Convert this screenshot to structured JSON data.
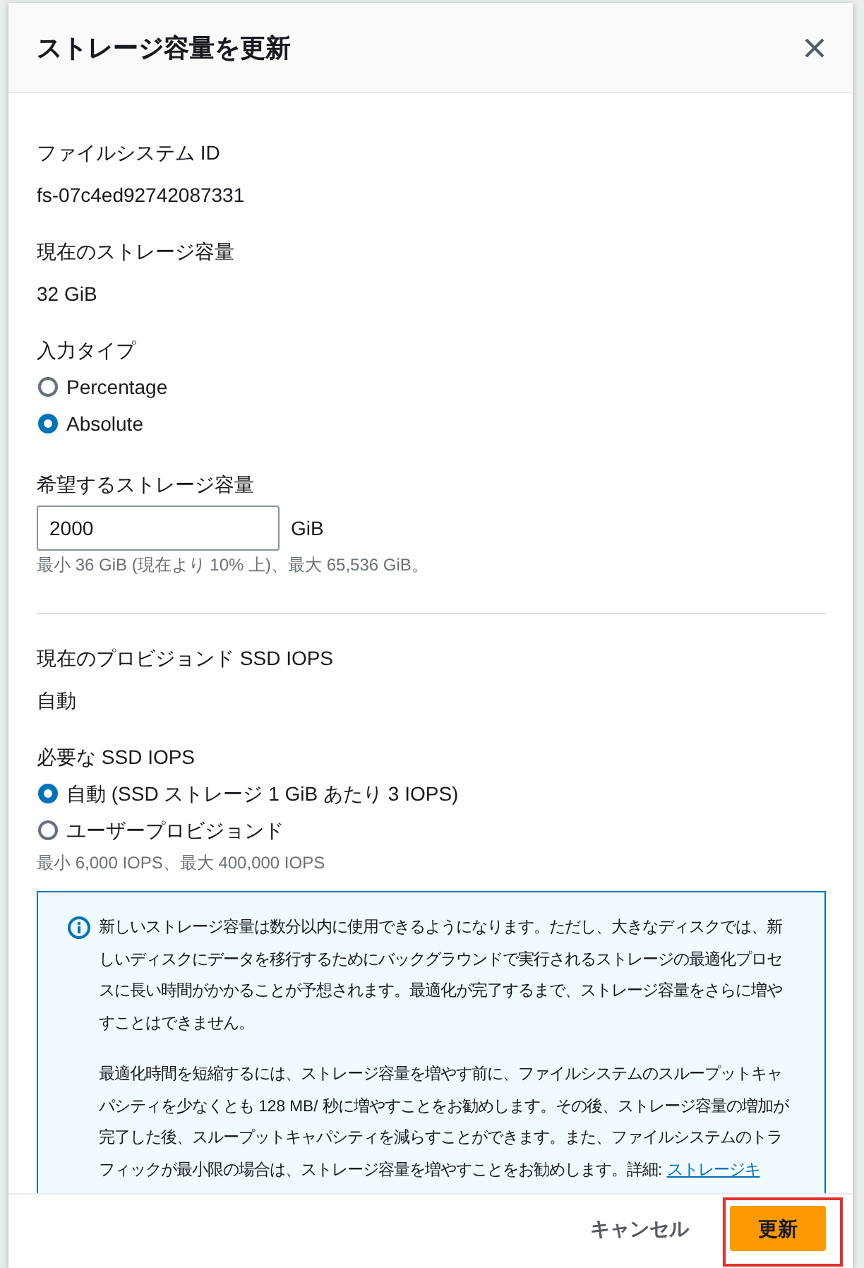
{
  "dialog": {
    "title": "ストレージ容量を更新"
  },
  "fields": [
    {
      "kind": "readonly",
      "label": "ファイルシステム ID",
      "value": "fs-07c4ed92742087331"
    },
    {
      "kind": "readonly",
      "label": "現在のストレージ容量",
      "value": "32 GiB"
    },
    {
      "kind": "radio",
      "label": "入力タイプ",
      "options": [
        {
          "label": "Percentage",
          "selected": false
        },
        {
          "label": "Absolute",
          "selected": true
        }
      ]
    },
    {
      "kind": "input",
      "label": "希望するストレージ容量",
      "value": "2000",
      "unit": "GiB",
      "hint": "最小 36 GiB (現在より 10% 上)、最大 65,536 GiB。"
    },
    {
      "kind": "divider"
    },
    {
      "kind": "readonly",
      "label": "現在のプロビジョンド SSD IOPS",
      "value": "自動"
    },
    {
      "kind": "radio",
      "label": "必要な SSD IOPS",
      "options": [
        {
          "label": "自動 (SSD ストレージ 1 GiB あたり 3 IOPS)",
          "selected": true
        },
        {
          "label": "ユーザープロビジョンド",
          "selected": false
        }
      ],
      "hint": "最小 6,000 IOPS、最大 400,000 IOPS"
    },
    {
      "kind": "info",
      "paragraphs": [
        {
          "text": "新しいストレージ容量は数分以内に使用できるようになります。ただし、大きなディスクでは、新しいディスクにデータを移行するためにバックグラウンドで実行されるストレージの最適化プロセスに長い時間がかかることが予想されます。最適化が完了するまで、ストレージ容量をさらに増やすことはできません。"
        },
        {
          "text": "最適化時間を短縮するには、ストレージ容量を増やす前に、ファイルシステムのスループットキャパシティを少なくとも 128 MB/ 秒に増やすことをお勧めします。その後、ストレージ容量の増加が完了した後、スループットキャパシティを減らすことができます。また、ファイルシステムのトラフィックが最小限の場合は、ストレージ容量を増やすことをお勧めします。詳細:",
          "link": "ストレージキ"
        }
      ]
    }
  ],
  "footer": {
    "buttons": [
      {
        "kind": "link",
        "label": "キャンセル",
        "highlighted": false
      },
      {
        "kind": "primary",
        "label": "更新",
        "highlighted": true
      }
    ]
  }
}
